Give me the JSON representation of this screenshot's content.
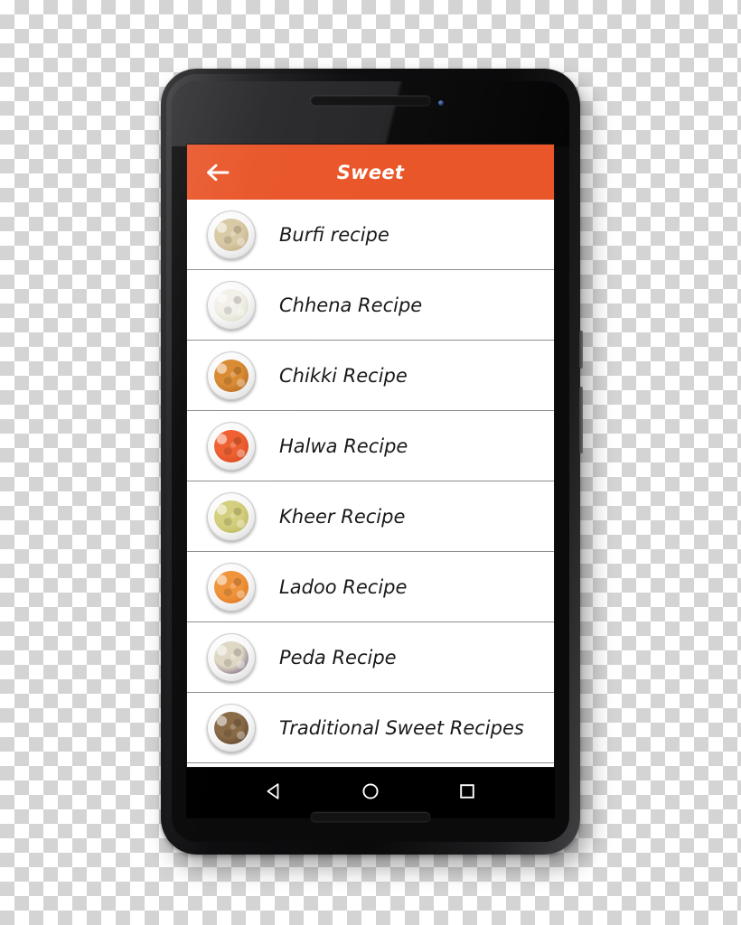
{
  "app": {
    "title": "Sweet",
    "accent_color": "#E9562A",
    "back_icon": "arrow-left-icon"
  },
  "recipes": [
    {
      "label": "Burfi recipe",
      "thumb_color": "#d8c9a4",
      "thumb_color2": "#b8a47a",
      "icon": "burfi-thumbnail"
    },
    {
      "label": "Chhena Recipe",
      "thumb_color": "#f2f0e8",
      "thumb_color2": "#cfd6bb",
      "icon": "chhena-thumbnail"
    },
    {
      "label": "Chikki Recipe",
      "thumb_color": "#d98a31",
      "thumb_color2": "#a85e16",
      "icon": "chikki-thumbnail"
    },
    {
      "label": "Halwa Recipe",
      "thumb_color": "#ef5f30",
      "thumb_color2": "#cf3f12",
      "icon": "halwa-thumbnail"
    },
    {
      "label": "Kheer Recipe",
      "thumb_color": "#d4cf7d",
      "thumb_color2": "#b3ad50",
      "icon": "kheer-thumbnail"
    },
    {
      "label": "Ladoo Recipe",
      "thumb_color": "#f0933b",
      "thumb_color2": "#d46b14",
      "icon": "ladoo-thumbnail"
    },
    {
      "label": "Peda Recipe",
      "thumb_color": "#ded8c4",
      "thumb_color2": "#5b3f74",
      "icon": "peda-thumbnail"
    },
    {
      "label": "Traditional Sweet Recipes",
      "thumb_color": "#8a6b48",
      "thumb_color2": "#4c3824",
      "icon": "traditional-sweet-thumbnail"
    }
  ],
  "nav_bar": {
    "back": "nav-back-triangle-icon",
    "home": "nav-home-circle-icon",
    "recents": "nav-recents-square-icon"
  }
}
